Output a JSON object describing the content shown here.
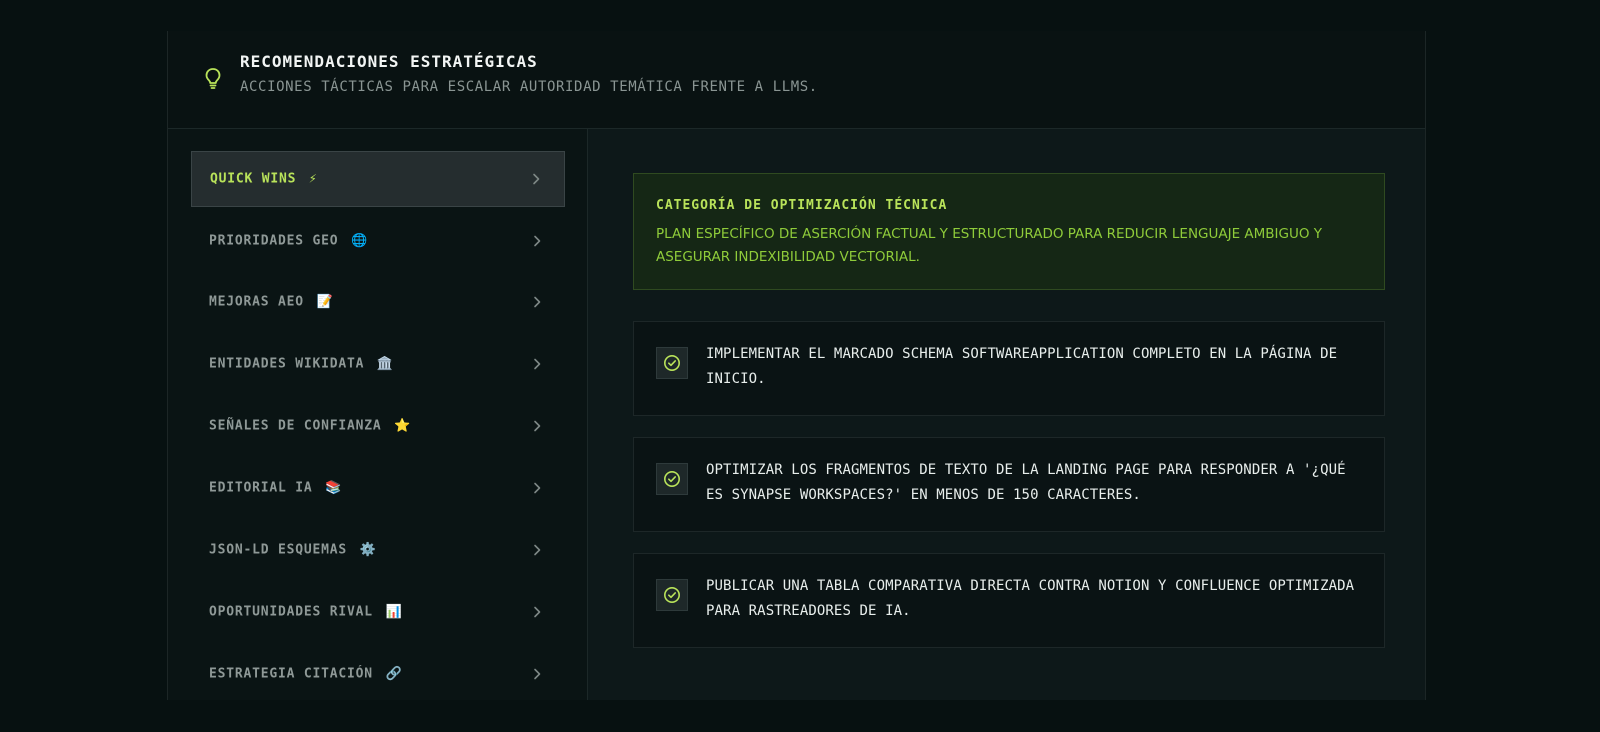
{
  "header": {
    "title": "RECOMENDACIONES ESTRATÉGICAS",
    "subtitle": "ACCIONES TÁCTICAS PARA ESCALAR AUTORIDAD TEMÁTICA FRENTE A LLMS.",
    "icon": "lightbulb-icon"
  },
  "sidebar": {
    "items": [
      {
        "label": "QUICK WINS",
        "emoji": "⚡",
        "active": true
      },
      {
        "label": "PRIORIDADES GEO",
        "emoji": "🌐",
        "active": false
      },
      {
        "label": "MEJORAS AEO",
        "emoji": "📝",
        "active": false
      },
      {
        "label": "ENTIDADES WIKIDATA",
        "emoji": "🏛️",
        "active": false
      },
      {
        "label": "SEÑALES DE CONFIANZA",
        "emoji": "⭐",
        "active": false
      },
      {
        "label": "EDITORIAL IA",
        "emoji": "📚",
        "active": false
      },
      {
        "label": "JSON-LD ESQUEMAS",
        "emoji": "⚙️",
        "active": false
      },
      {
        "label": "OPORTUNIDADES RIVAL",
        "emoji": "📊",
        "active": false
      },
      {
        "label": "ESTRATEGIA CITACIÓN",
        "emoji": "🔗",
        "active": false
      }
    ]
  },
  "main": {
    "category": {
      "title": "CATEGORÍA DE OPTIMIZACIÓN TÉCNICA",
      "description": "PLAN ESPECÍFICO DE ASERCIÓN FACTUAL Y ESTRUCTURADO PARA REDUCIR LENGUAJE AMBIGUO Y ASEGURAR INDEXIBILIDAD VECTORIAL."
    },
    "tasks": [
      {
        "text": "IMPLEMENTAR EL MARCADO SCHEMA SOFTWAREAPPLICATION COMPLETO EN LA PÁGINA DE INICIO."
      },
      {
        "text": "OPTIMIZAR LOS FRAGMENTOS DE TEXTO DE LA LANDING PAGE PARA RESPONDER A '¿QUÉ ES SYNAPSE WORKSPACES?' EN MENOS DE 150 CARACTERES."
      },
      {
        "text": "PUBLICAR UNA TABLA COMPARATIVA DIRECTA CONTRA NOTION Y CONFLUENCE OPTIMIZADA PARA RASTREADORES DE IA."
      }
    ]
  },
  "colors": {
    "accent": "#b9e35a",
    "background": "#071111",
    "panel": "#0a1414"
  }
}
